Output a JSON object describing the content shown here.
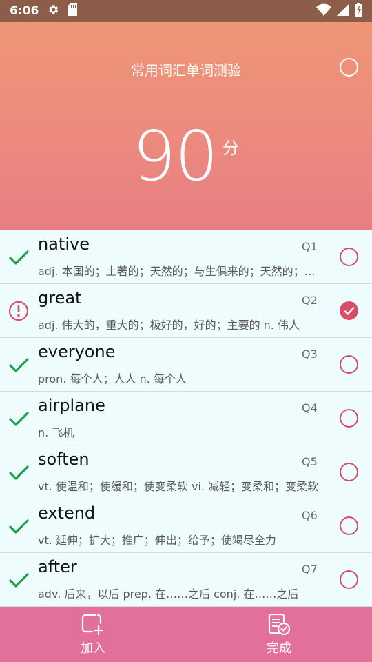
{
  "status_bar": {
    "time": "6:06"
  },
  "header": {
    "title": "常用词汇单词测验",
    "score": "90",
    "score_unit": "分"
  },
  "colors": {
    "correct": "#1aa04a",
    "wrong": "#d84d6a",
    "accent": "#e2709a"
  },
  "words": [
    {
      "word": "native",
      "q": "Q1",
      "def": "adj. 本国的；土著的；天然的；与生俱来的；天然的；与生俱来的",
      "result": "correct",
      "selected": false
    },
    {
      "word": "great",
      "q": "Q2",
      "def": "adj. 伟大的，重大的；极好的，好的；主要的 n. 伟人",
      "result": "wrong",
      "selected": true
    },
    {
      "word": "everyone",
      "q": "Q3",
      "def": "pron. 每个人；人人 n. 每个人",
      "result": "correct",
      "selected": false
    },
    {
      "word": "airplane",
      "q": "Q4",
      "def": "n. 飞机",
      "result": "correct",
      "selected": false
    },
    {
      "word": "soften",
      "q": "Q5",
      "def": "vt. 使温和；使缓和；使变柔软 vi. 减轻；变柔和；变柔软",
      "result": "correct",
      "selected": false
    },
    {
      "word": "extend",
      "q": "Q6",
      "def": "vt. 延伸；扩大；推广；伸出；给予；使竭尽全力",
      "result": "correct",
      "selected": false
    },
    {
      "word": "after",
      "q": "Q7",
      "def": "adv. 后来，以后 prep. 在……之后 conj. 在……之后",
      "result": "correct",
      "selected": false
    }
  ],
  "bottom_bar": {
    "add_label": "加入",
    "done_label": "完成"
  }
}
